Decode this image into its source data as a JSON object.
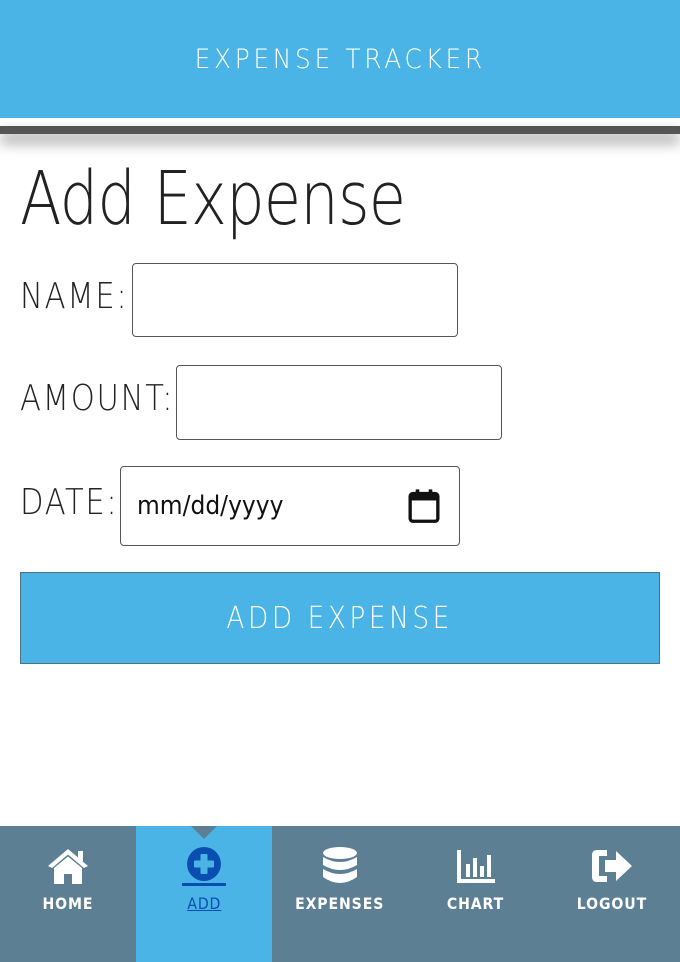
{
  "header": {
    "title": "EXPENSE TRACKER"
  },
  "page": {
    "title": "Add Expense"
  },
  "form": {
    "name_label": "NAME:",
    "name_value": "",
    "amount_label": "AMOUNT:",
    "amount_value": "",
    "date_label": "DATE:",
    "date_placeholder": "mm/dd/yyyy",
    "submit_label": "ADD EXPENSE"
  },
  "nav": {
    "items": [
      {
        "label": "HOME",
        "icon": "home-icon",
        "active": false
      },
      {
        "label": "ADD",
        "icon": "plus-circle-icon",
        "active": true
      },
      {
        "label": "EXPENSES",
        "icon": "database-icon",
        "active": false
      },
      {
        "label": "CHART",
        "icon": "bar-chart-icon",
        "active": false
      },
      {
        "label": "LOGOUT",
        "icon": "logout-icon",
        "active": false
      }
    ]
  },
  "colors": {
    "accent": "#4ab4e6",
    "navbar": "#5d7f94",
    "active_label": "#0a4fb0"
  }
}
